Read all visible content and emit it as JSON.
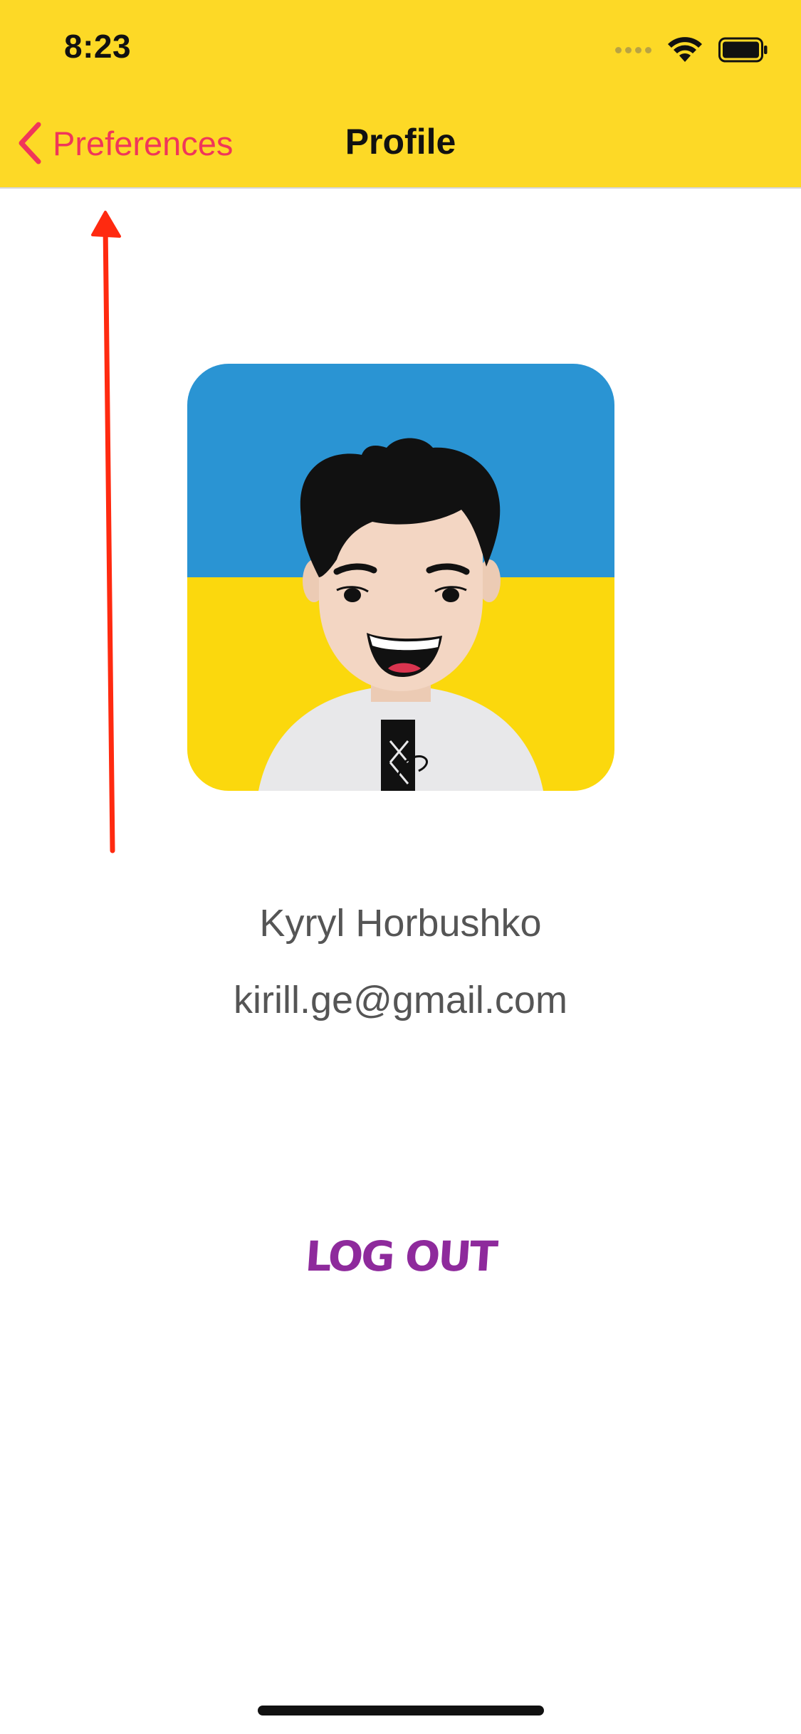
{
  "status_bar": {
    "time": "8:23"
  },
  "nav": {
    "back_label": "Preferences",
    "title": "Profile"
  },
  "profile": {
    "name": "Kyryl Horbushko",
    "email": "kirill.ge@gmail.com"
  },
  "actions": {
    "logout_label": "LOG OUT"
  },
  "colors": {
    "header_background": "#fdd926",
    "back_tint": "#f0365a",
    "logout_color": "#8e2a9c",
    "avatar_sky": "#2a94d3",
    "avatar_field": "#fbd80d",
    "annotation_arrow": "#ff2a10"
  },
  "icons": {
    "back": "chevron-left-icon",
    "wifi": "wifi-icon",
    "battery": "battery-icon",
    "annotation": "arrow-up-icon"
  }
}
